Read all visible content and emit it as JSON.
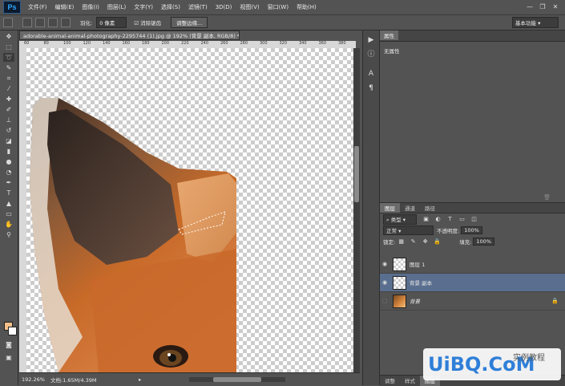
{
  "app": {
    "logo": "Ps"
  },
  "menu": [
    "文件(F)",
    "编辑(E)",
    "图像(I)",
    "图层(L)",
    "文字(Y)",
    "选择(S)",
    "滤镜(T)",
    "3D(D)",
    "视图(V)",
    "窗口(W)",
    "帮助(H)"
  ],
  "window_controls": {
    "minimize": "—",
    "restore": "❐",
    "close": "✕"
  },
  "options": {
    "feather_label": "羽化:",
    "feather_value": "0 像素",
    "antialias_label": "消除锯齿",
    "refine_edge_button": "调整边缘...",
    "workspace": "基本功能"
  },
  "document": {
    "tab_title": "adorable-animal-animal-photography-2295744 (1).jpg @ 192% (背景 副本, RGB/8) *",
    "zoom": "192.26%",
    "doc_size": "文档:1.65M/4.39M"
  },
  "ruler": {
    "top_ticks": [
      "60",
      "80",
      "100",
      "120",
      "140",
      "160",
      "180",
      "200",
      "220",
      "240",
      "260",
      "280",
      "300",
      "320",
      "340",
      "360",
      "380"
    ]
  },
  "properties": {
    "tab_label": "属性",
    "body": "无属性"
  },
  "layers": {
    "tabs": [
      "图层",
      "通道",
      "路径"
    ],
    "filter_label": "类型",
    "blend_mode": "正常",
    "opacity_label": "不透明度:",
    "opacity_value": "100%",
    "lock_label": "锁定:",
    "fill_label": "填充:",
    "fill_value": "100%",
    "items": [
      {
        "name": "图层 1"
      },
      {
        "name": "背景 副本"
      },
      {
        "name": "背景"
      }
    ]
  },
  "bottom_tabs": [
    "调整",
    "样式",
    "图层"
  ],
  "watermark": {
    "text": "UiBQ.CoM",
    "sub": "实例教程"
  },
  "colors": {
    "foreground": "#f5c08a",
    "background": "#ffffff",
    "selected_layer": "#5a6f8f"
  }
}
